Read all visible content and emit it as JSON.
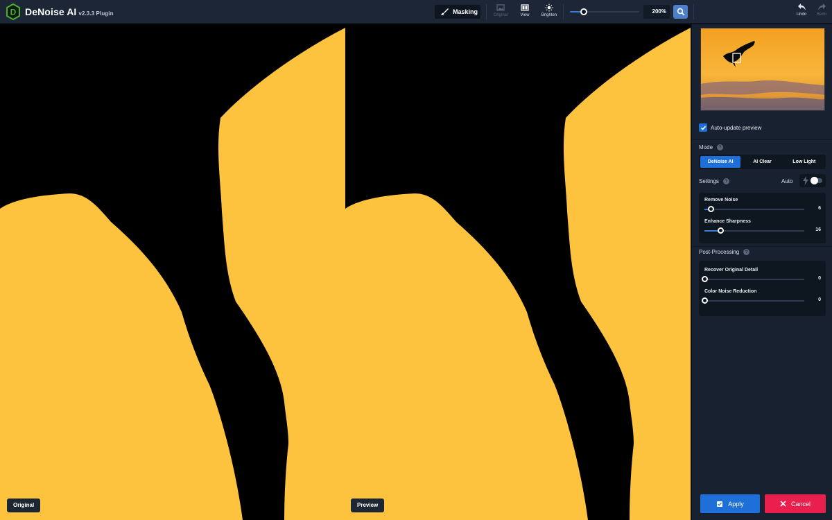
{
  "app": {
    "title": "DeNoise AI",
    "version": "v2.3.3 Plugin",
    "logo_icon": "denoise-logo-icon",
    "brand_color": "#4caf30"
  },
  "toolbar": {
    "masking_label": "Masking",
    "tools": {
      "original": {
        "label": "Original",
        "icon": "image-icon",
        "enabled": false
      },
      "view": {
        "label": "View",
        "icon": "split-view-icon",
        "enabled": true
      },
      "brighten": {
        "label": "Brighten",
        "icon": "sun-icon",
        "enabled": true
      }
    },
    "zoom": {
      "value_label": "200%",
      "slider_level": 0.2
    },
    "undo_label": "Undo",
    "redo_label": "Redo"
  },
  "canvas": {
    "left_label": "Original",
    "right_label": "Preview",
    "subject_color": "#fdc33e",
    "background_color": "#000000"
  },
  "panel": {
    "auto_update": {
      "label": "Auto-update preview",
      "checked": true
    },
    "mode": {
      "title": "Mode",
      "options": [
        "DeNoise AI",
        "AI Clear",
        "Low Light"
      ],
      "selected": "DeNoise AI"
    },
    "settings": {
      "title": "Settings",
      "auto_label": "Auto",
      "auto_enabled": false,
      "sliders": [
        {
          "label": "Remove Noise",
          "value": "6",
          "level": 0.06
        },
        {
          "label": "Enhance Sharpness",
          "value": "16",
          "level": 0.16
        }
      ]
    },
    "post_processing": {
      "title": "Post-Processing",
      "sliders": [
        {
          "label": "Recover Original Detail",
          "value": "0",
          "level": 0
        },
        {
          "label": "Color Noise Reduction",
          "value": "0",
          "level": 0
        }
      ]
    },
    "apply_label": "Apply",
    "cancel_label": "Cancel",
    "accent_color": "#1f6fd9",
    "cancel_color": "#ea1f4e"
  }
}
